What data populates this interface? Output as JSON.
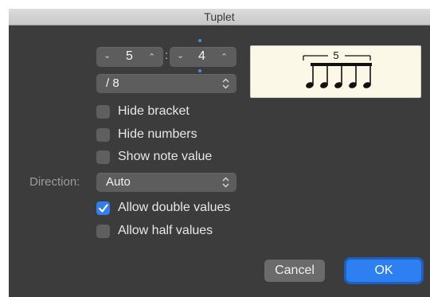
{
  "window": {
    "title": "Tuplet"
  },
  "ratio": {
    "numerator": "5",
    "separator": ":",
    "denominator": "4"
  },
  "unit_popup": {
    "value": "/ 8"
  },
  "checkboxes": [
    {
      "label": "Hide bracket",
      "checked": false
    },
    {
      "label": "Hide numbers",
      "checked": false
    },
    {
      "label": "Show note value",
      "checked": false
    }
  ],
  "direction": {
    "label": "Direction:",
    "value": "Auto"
  },
  "options": [
    {
      "label": "Allow double values",
      "checked": true
    },
    {
      "label": "Allow half values",
      "checked": false
    }
  ],
  "preview": {
    "tuplet_number": "5",
    "note_count": 5
  },
  "buttons": {
    "cancel": "Cancel",
    "ok": "OK"
  },
  "colors": {
    "accent": "#2e7ff2",
    "background": "#3c3c3c"
  }
}
